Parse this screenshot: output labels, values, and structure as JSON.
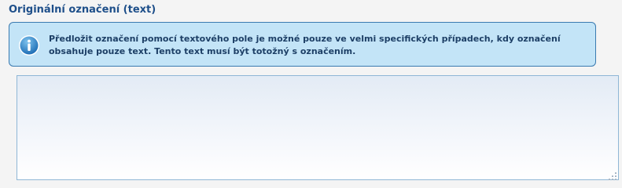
{
  "section": {
    "title": "Originální označení (text)"
  },
  "info": {
    "icon": "info-icon",
    "text": "Předložit označení pomocí textového pole je možné pouze ve velmi specifických případech, kdy označení obsahuje pouze text. Tento text musí být totožný s označením."
  },
  "text_field": {
    "value": "",
    "resize_icon": "resize-grip-icon"
  },
  "colors": {
    "title": "#1e4f8a",
    "info_background": "#c3e4f7",
    "info_border": "#3a7ab0",
    "field_border": "#8fb7d6"
  }
}
